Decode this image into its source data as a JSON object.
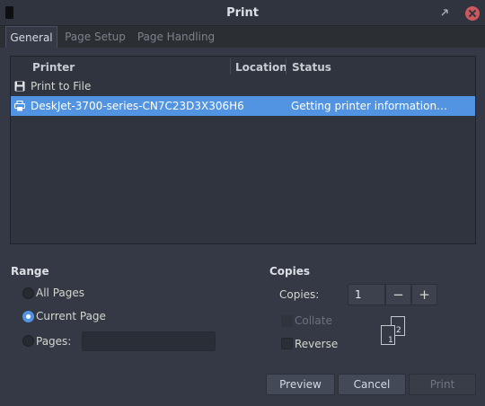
{
  "window": {
    "title": "Print"
  },
  "tabs": [
    {
      "label": "General",
      "active": true
    },
    {
      "label": "Page Setup",
      "active": false
    },
    {
      "label": "Page Handling",
      "active": false
    }
  ],
  "printer_list": {
    "columns": [
      "Printer",
      "Location",
      "Status"
    ],
    "rows": [
      {
        "icon": "floppy-disk-icon",
        "name": "Print to File",
        "location": "",
        "status": "",
        "selected": false
      },
      {
        "icon": "printer-icon",
        "name": "DeskJet-3700-series-CN7C23D3X306H6",
        "location": "",
        "status": "Getting printer information…",
        "selected": true
      }
    ]
  },
  "range": {
    "title": "Range",
    "options": [
      {
        "label": "All Pages",
        "checked": false
      },
      {
        "label": "Current Page",
        "checked": true
      },
      {
        "label": "Pages:",
        "checked": false
      }
    ],
    "pages_value": ""
  },
  "copies": {
    "title": "Copies",
    "label": "Copies:",
    "value": "1",
    "minus": "−",
    "plus": "+",
    "collate_label": "Collate",
    "collate_checked": false,
    "collate_enabled": false,
    "reverse_label": "Reverse",
    "reverse_checked": false,
    "sheet_back": "2",
    "sheet_front": "1"
  },
  "buttons": {
    "preview": "Preview",
    "cancel": "Cancel",
    "print": "Print"
  },
  "colors": {
    "accent": "#5294e2",
    "close": "#cc575d",
    "background": "#353945"
  }
}
